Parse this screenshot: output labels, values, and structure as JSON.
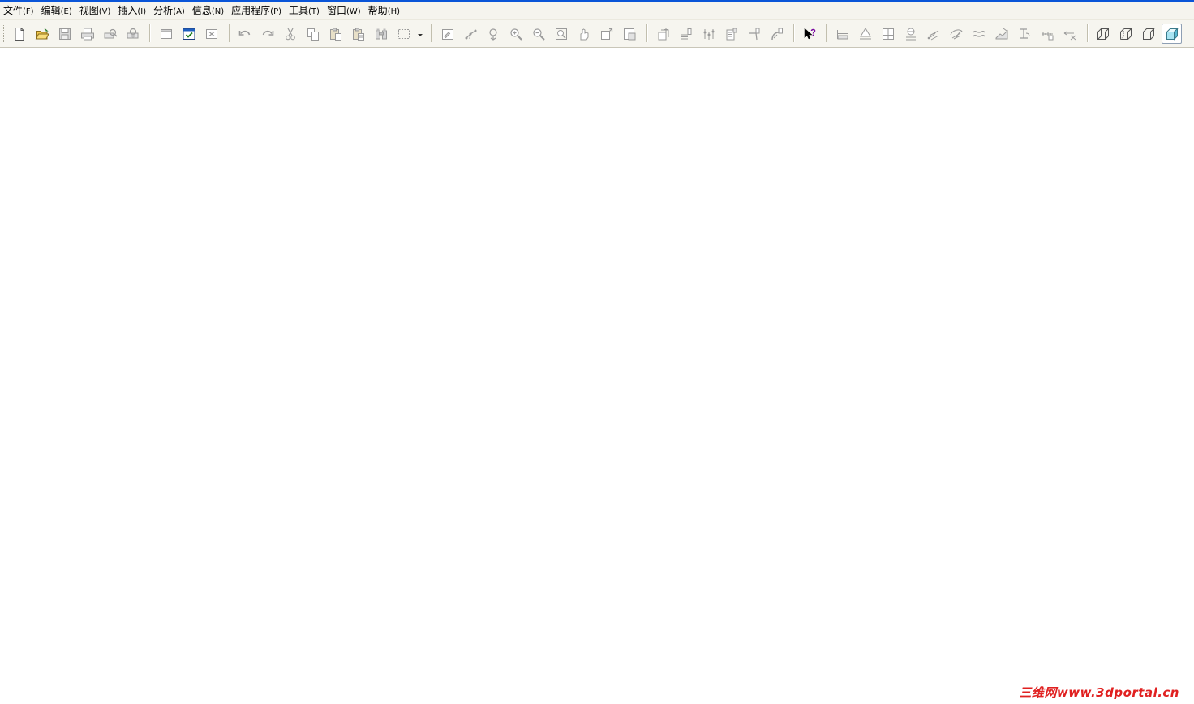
{
  "menu": [
    {
      "label": "文件",
      "accel": "(F)"
    },
    {
      "label": "编辑",
      "accel": "(E)"
    },
    {
      "label": "视图",
      "accel": "(V)"
    },
    {
      "label": "插入",
      "accel": "(I)"
    },
    {
      "label": "分析",
      "accel": "(A)"
    },
    {
      "label": "信息",
      "accel": "(N)"
    },
    {
      "label": "应用程序",
      "accel": "(P)"
    },
    {
      "label": "工具",
      "accel": "(T)"
    },
    {
      "label": "窗口",
      "accel": "(W)"
    },
    {
      "label": "帮助",
      "accel": "(H)"
    }
  ],
  "toolbar_icons": [
    "new-file-icon",
    "open-folder-icon",
    "save-icon",
    "print-icon",
    "print-preview-icon",
    "shaded-print-icon",
    "window-new-icon",
    "window-activate-icon",
    "window-close-icon",
    "undo-icon",
    "redo-icon",
    "cut-icon",
    "copy-icon",
    "paste-icon",
    "paste-special-icon",
    "find-replace-icon",
    "selection-box-icon",
    "repaint-icon",
    "orient-icon",
    "spin-icon",
    "zoom-in-icon",
    "zoom-out-icon",
    "zoom-window-icon",
    "pan-icon",
    "refit-icon",
    "saved-view-icon",
    "datum-plane-icon",
    "datum-axis-icon",
    "datum-point-icon",
    "coordinate-system-icon",
    "datum-curve-icon",
    "sketch-icon",
    "context-help-icon",
    "dimension-linear-icon",
    "dimension-height-icon",
    "table-icon",
    "datum-target-icon",
    "note-icon",
    "surface-finish-icon",
    "wave-icon",
    "section-icon",
    "text-icon",
    "ruler-icon",
    "measure-icon",
    "wireframe-icon",
    "hidden-line-icon",
    "no-hidden-icon",
    "shading-icon"
  ],
  "watermark": "三维网www.3dportal.cn"
}
